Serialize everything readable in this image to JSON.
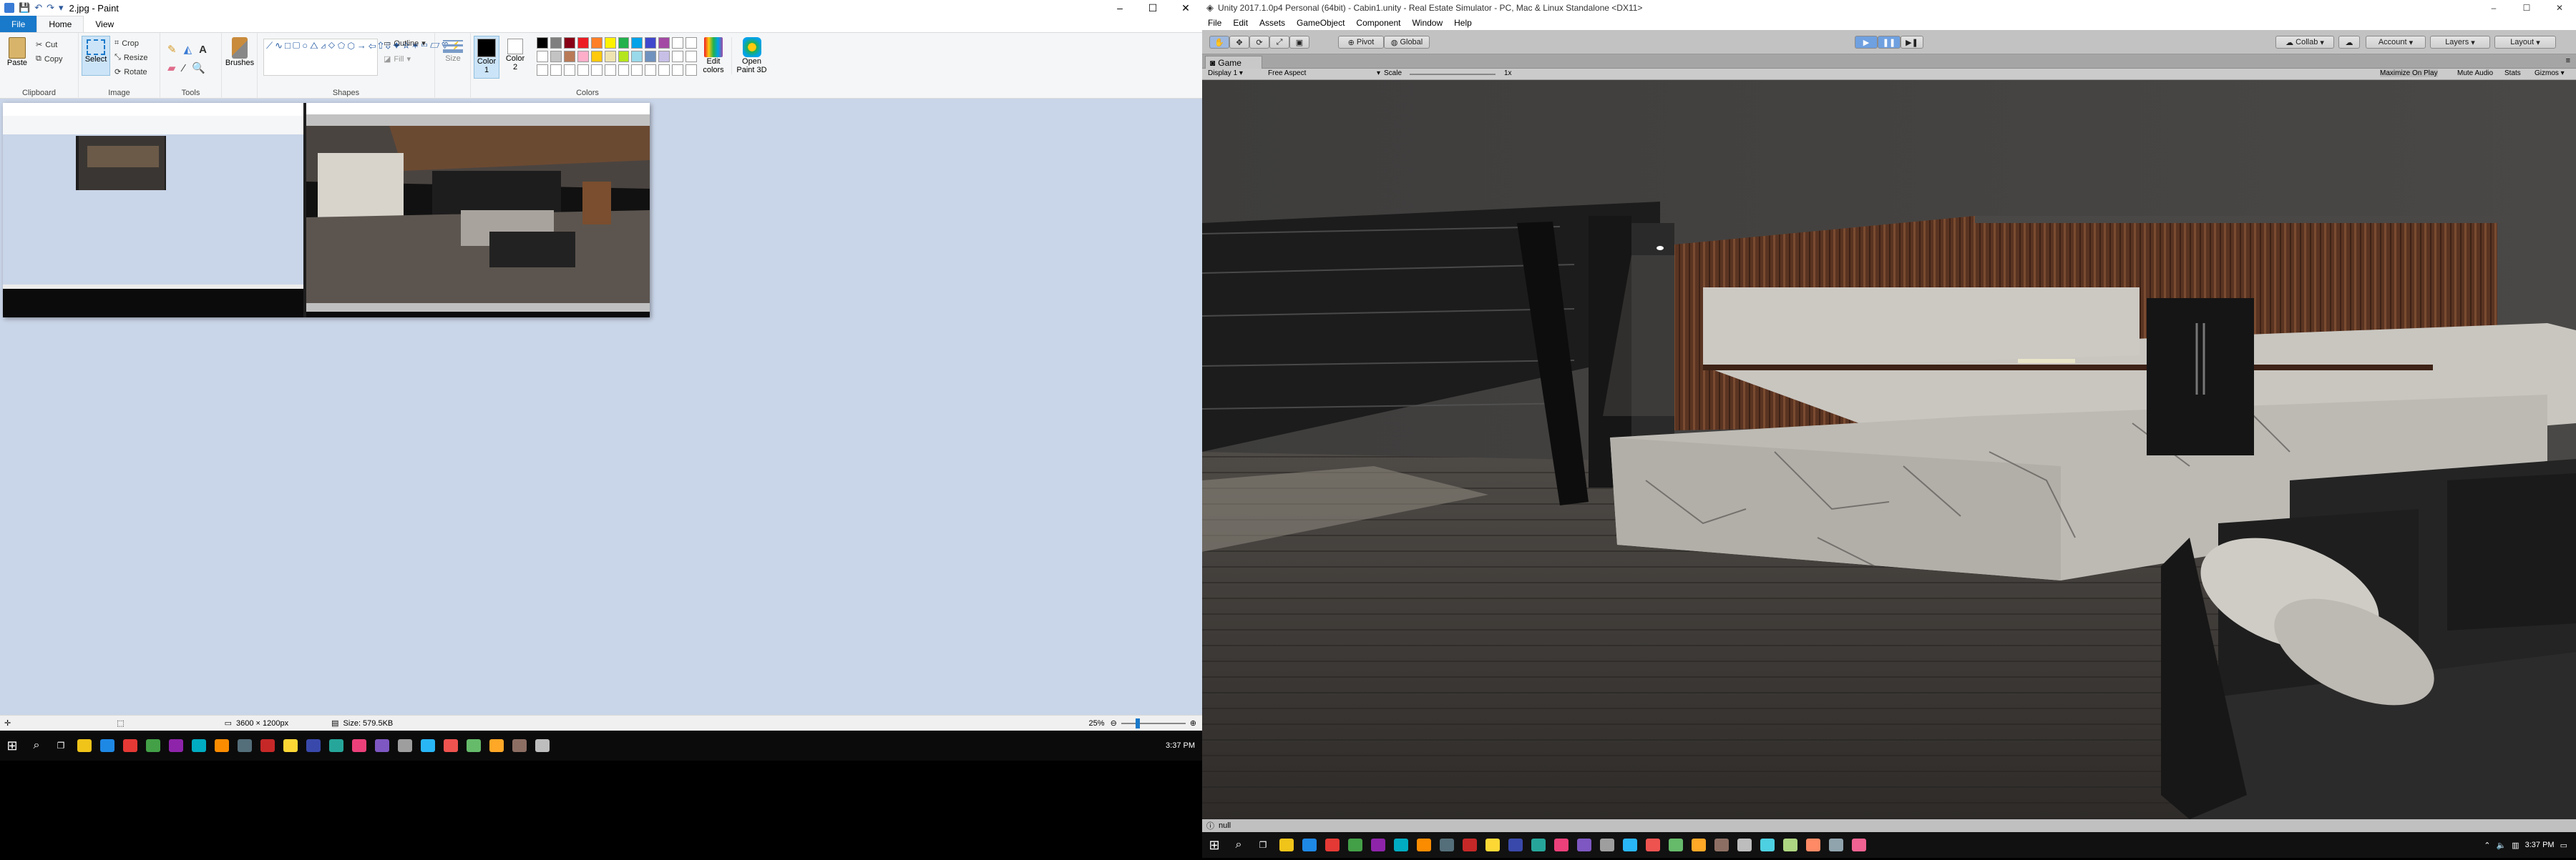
{
  "paint": {
    "title": "2.jpg - Paint",
    "window_controls": [
      "–",
      "☐",
      "✕"
    ],
    "tabs": [
      "File",
      "Home",
      "View"
    ],
    "clipboard": {
      "paste": "Paste",
      "cut": "Cut",
      "copy": "Copy",
      "label": "Clipboard"
    },
    "image": {
      "select": "Select",
      "crop": "Crop",
      "resize": "Resize",
      "rotate": "Rotate",
      "label": "Image"
    },
    "tools": {
      "label": "Tools"
    },
    "brushes": "Brushes",
    "shapes": {
      "outline": "Outline",
      "fill": "Fill",
      "label": "Shapes"
    },
    "size": "Size",
    "color1": "Color 1",
    "color2": "Color 2",
    "colors_label": "Colors",
    "edit_colors": "Edit colors",
    "open_paint3d": "Open Paint 3D",
    "palette_row1": [
      "#000000",
      "#7f7f7f",
      "#880015",
      "#ed1c24",
      "#ff7f27",
      "#fff200",
      "#22b14c",
      "#00a2e8",
      "#3f48cc",
      "#a349a4"
    ],
    "palette_row2": [
      "#ffffff",
      "#c3c3c3",
      "#b97a57",
      "#ffaec9",
      "#ffc90e",
      "#efe4b0",
      "#b5e61d",
      "#99d9ea",
      "#7092be",
      "#c8bfe7"
    ],
    "status": {
      "dimensions": "3600 × 1200px",
      "size": "Size: 579.5KB",
      "zoom": "25%"
    },
    "taskbar_time": "3:37 PM"
  },
  "unity": {
    "title": "Unity 2017.1.0p4 Personal (64bit) - Cabin1.unity - Real Estate Simulator - PC, Mac & Linux Standalone <DX11>",
    "window_controls": [
      "–",
      "☐",
      "✕"
    ],
    "menu": [
      "File",
      "Edit",
      "Assets",
      "GameObject",
      "Component",
      "Window",
      "Help"
    ],
    "pivot": "Pivot",
    "global": "Global",
    "collab": "Collab",
    "account": "Account",
    "layers": "Layers",
    "layout": "Layout",
    "game_tab": "Game",
    "display": "Display 1",
    "aspect": "Free Aspect",
    "scale_label": "Scale",
    "scale_value": "1x",
    "maximize": "Maximize On Play",
    "mute": "Mute Audio",
    "stats": "Stats",
    "gizmos": "Gizmos",
    "status_text": "null",
    "taskbar_time": "3:37 PM"
  }
}
